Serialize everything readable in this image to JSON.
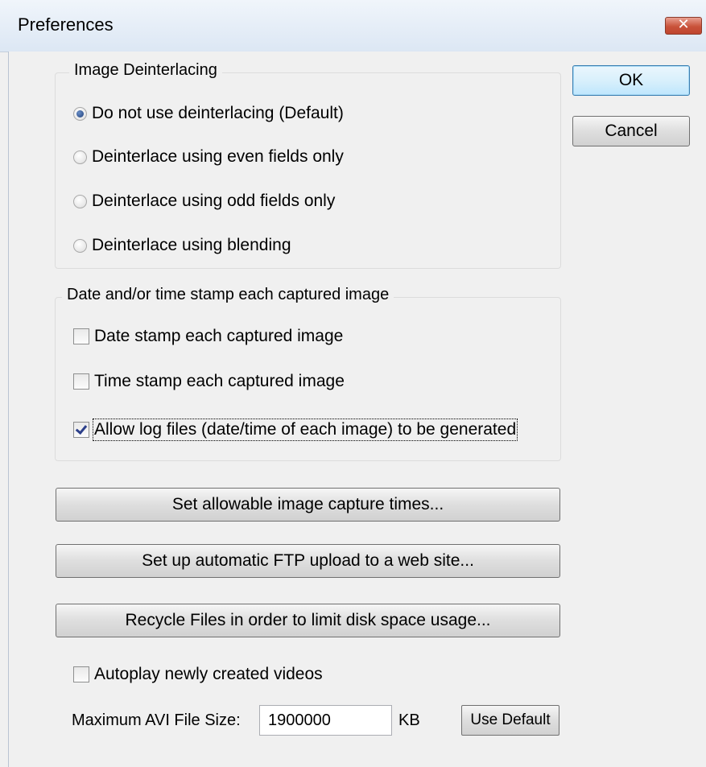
{
  "window": {
    "title": "Preferences",
    "close_glyph": "✕"
  },
  "actions": {
    "ok_label": "OK",
    "cancel_label": "Cancel"
  },
  "deinterlacing": {
    "legend": "Image Deinterlacing",
    "options": [
      {
        "label": "Do not use deinterlacing (Default)",
        "checked": true
      },
      {
        "label": "Deinterlace using even fields only",
        "checked": false
      },
      {
        "label": "Deinterlace using odd fields only",
        "checked": false
      },
      {
        "label": "Deinterlace using blending",
        "checked": false
      }
    ]
  },
  "timestamp": {
    "legend": "Date and/or time stamp each captured image",
    "options": [
      {
        "label": "Date stamp each captured image",
        "checked": false
      },
      {
        "label": "Time stamp each captured image",
        "checked": false
      },
      {
        "label": "Allow log files (date/time of each image) to be generated",
        "checked": true
      }
    ]
  },
  "buttons": {
    "capture_times": "Set allowable image capture times...",
    "ftp_upload": "Set up automatic FTP upload to a web site...",
    "recycle_files": "Recycle Files in order to limit disk space usage..."
  },
  "autoplay": {
    "label": "Autoplay newly created videos",
    "checked": false
  },
  "avi_size": {
    "label": "Maximum AVI File Size:",
    "value": "1900000",
    "unit": "KB",
    "default_button": "Use Default"
  },
  "colors": {
    "dialog_bg": "#f0f0f0",
    "default_button_border": "#3c7fb1",
    "close_button": "#c9523a"
  }
}
